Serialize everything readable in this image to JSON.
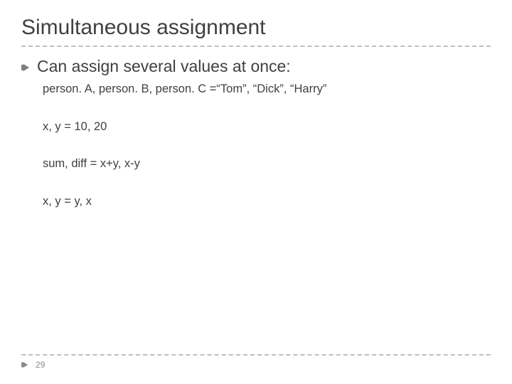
{
  "title": "Simultaneous assignment",
  "bullet": "Can assign several values at once:",
  "lines": {
    "l1": "person. A, person. B, person. C =“Tom”, “Dick”, “Harry”",
    "l2": "x, y = 10, 20",
    "l3": "sum, diff = x+y, x-y",
    "l4": "x, y = y, x"
  },
  "page_number": "29"
}
